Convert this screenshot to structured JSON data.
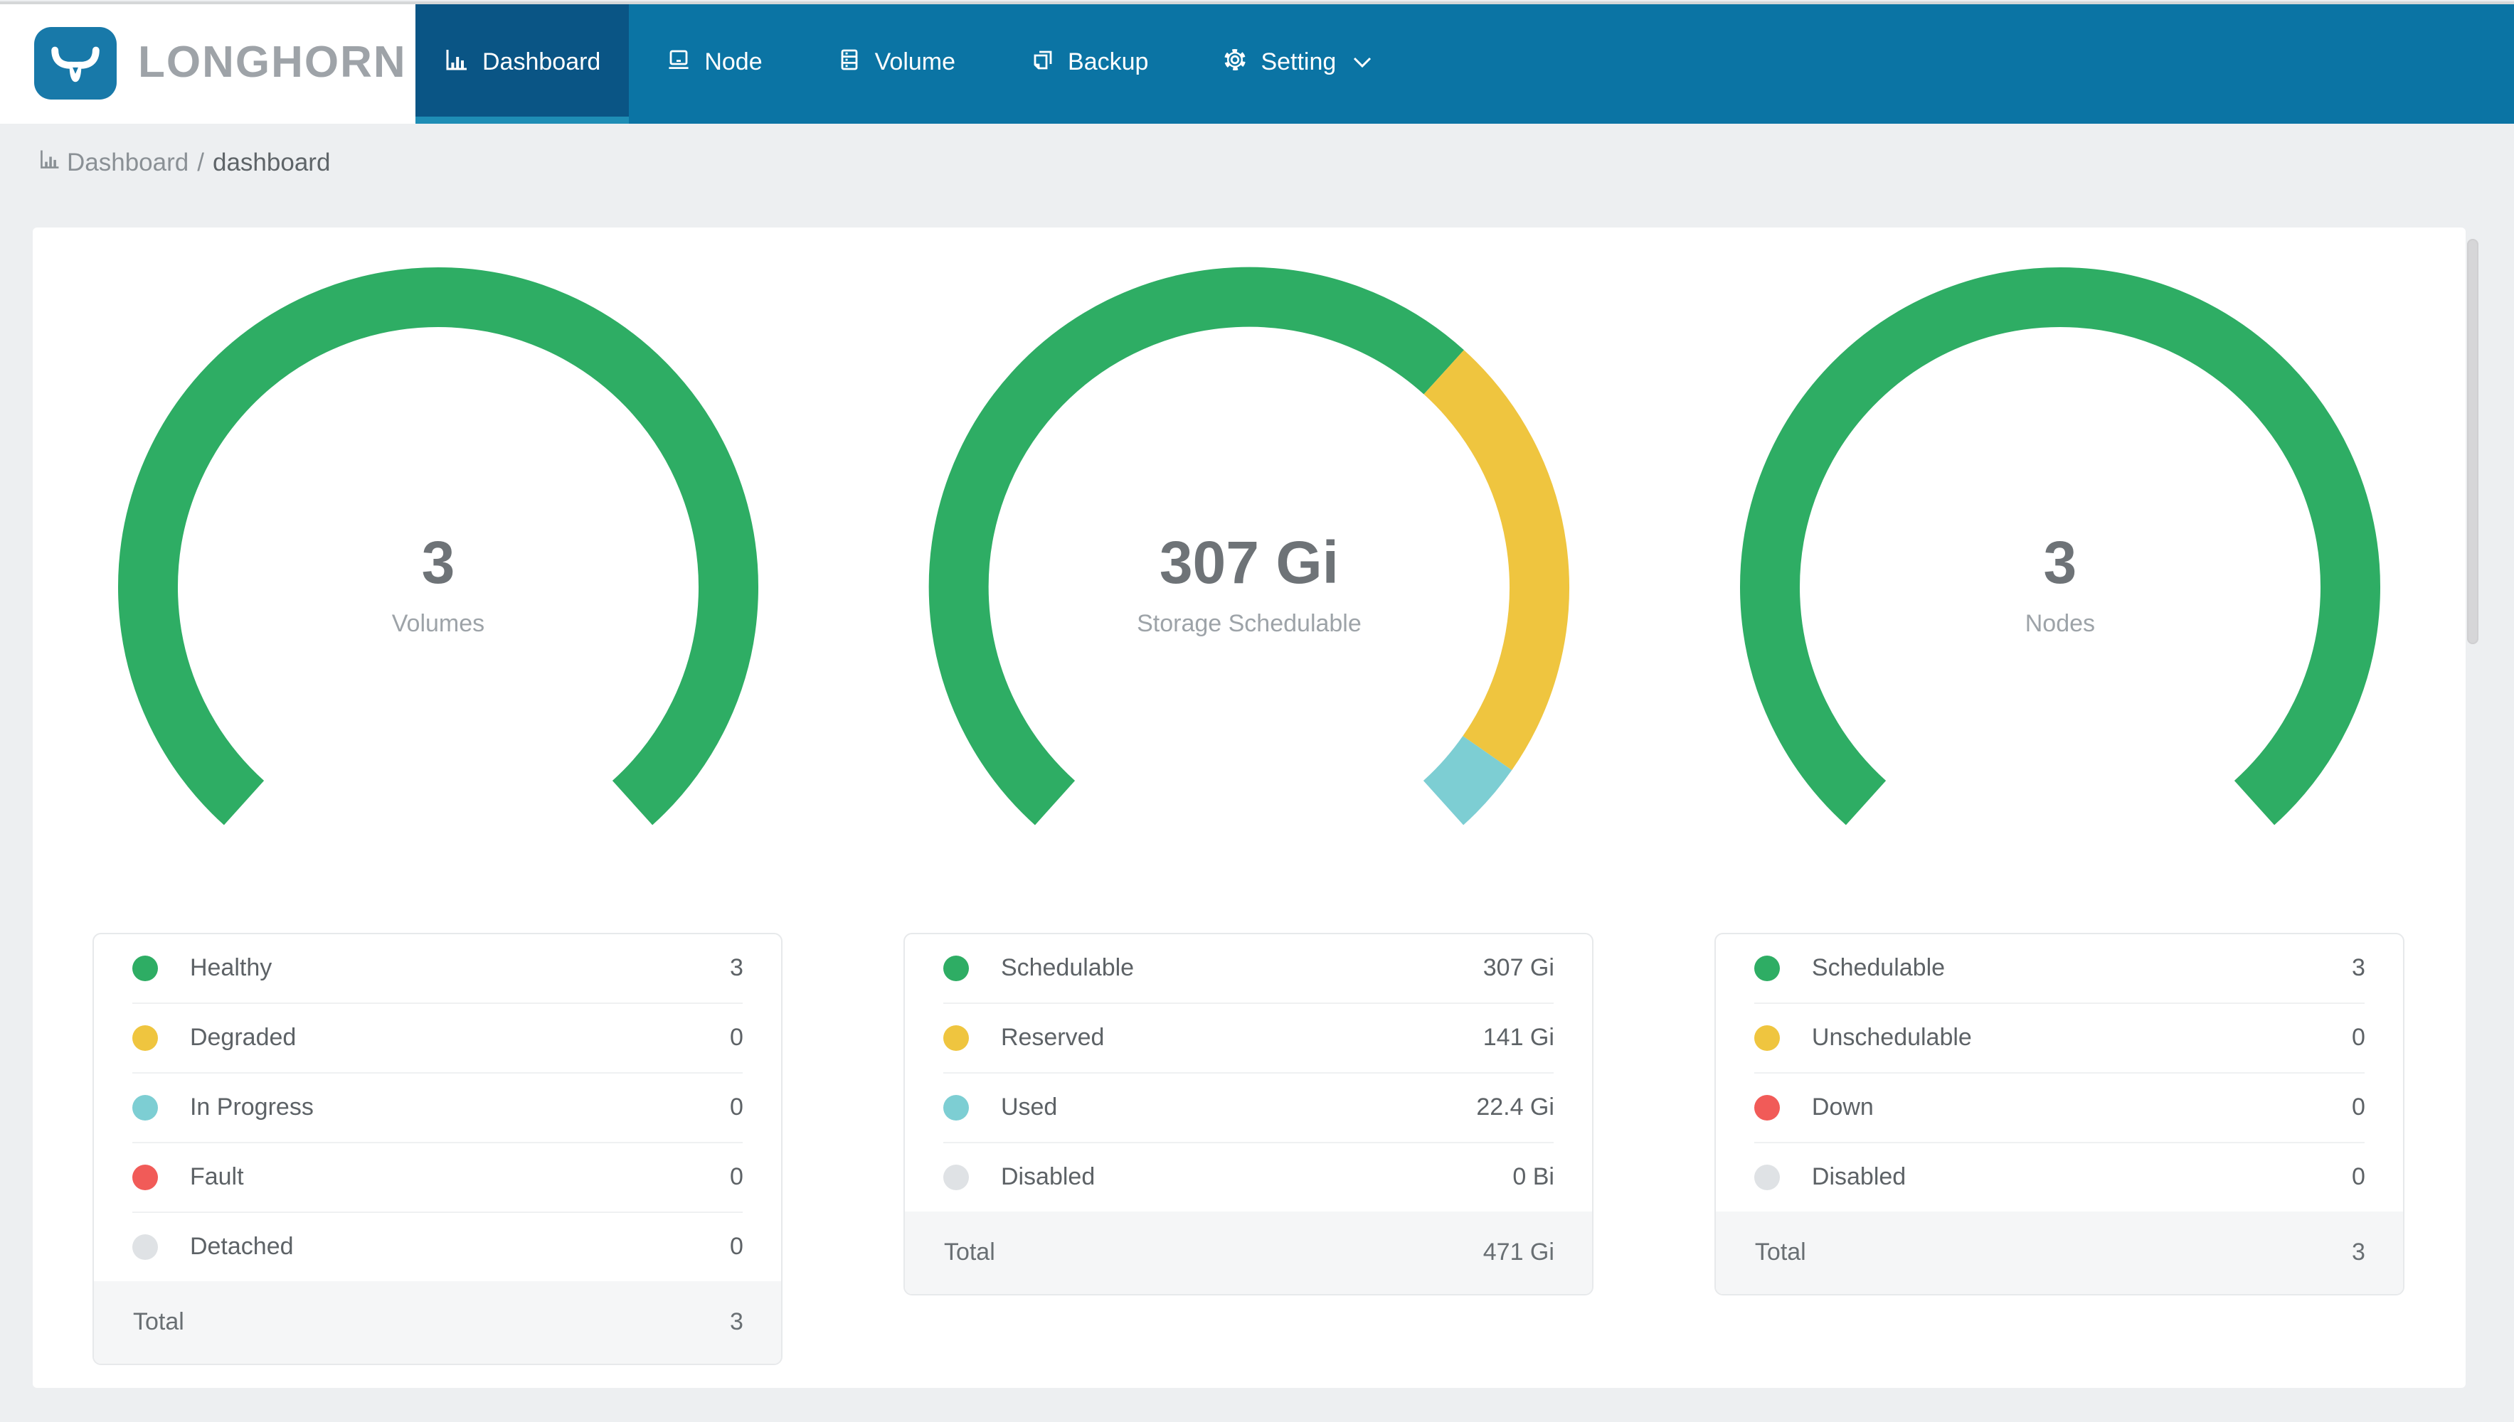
{
  "brand": {
    "name": "LONGHORN",
    "logo_icon": "bull-icon"
  },
  "nav": {
    "items": [
      {
        "label": "Dashboard",
        "icon": "bar-chart-icon",
        "active": true
      },
      {
        "label": "Node",
        "icon": "laptop-icon",
        "active": false
      },
      {
        "label": "Volume",
        "icon": "database-icon",
        "active": false
      },
      {
        "label": "Backup",
        "icon": "copy-icon",
        "active": false
      },
      {
        "label": "Setting",
        "icon": "gear-icon",
        "active": false,
        "has_dropdown": true,
        "dropdown_icon": "chevron-down-icon"
      }
    ]
  },
  "breadcrumb": {
    "icon": "bar-chart-icon",
    "items": [
      "Dashboard",
      "dashboard"
    ],
    "separator": "/"
  },
  "colors": {
    "nav_bg": "#0B74A4",
    "nav_active_bg": "#0A5585",
    "nav_active_underline": "#1E8DB5",
    "logo_blue": "#1879A9",
    "page_bg": "#EDEFF1",
    "card_bg": "#FFFFFF",
    "green": "#2EAD64",
    "yellow": "#EFC53F",
    "teal": "#7DCED3",
    "red": "#F15B58",
    "gray": "#DFE2E5"
  },
  "chart_data": [
    {
      "type": "gauge",
      "title": "Volumes",
      "center_value": "3",
      "center_label": "Volumes",
      "start_angle_deg": 228,
      "sweep_deg": 276,
      "legend_position": "below",
      "segments": [
        {
          "label": "Healthy",
          "value": 3,
          "color": "#2EAD64"
        },
        {
          "label": "Degraded",
          "value": 0,
          "color": "#EFC53F"
        },
        {
          "label": "In Progress",
          "value": 0,
          "color": "#7DCED3"
        },
        {
          "label": "Fault",
          "value": 0,
          "color": "#F15B58"
        },
        {
          "label": "Detached",
          "value": 0,
          "color": "#DFE2E5"
        }
      ],
      "legend": [
        {
          "label": "Healthy",
          "value": "3",
          "color": "#2EAD64"
        },
        {
          "label": "Degraded",
          "value": "0",
          "color": "#EFC53F"
        },
        {
          "label": "In Progress",
          "value": "0",
          "color": "#7DCED3"
        },
        {
          "label": "Fault",
          "value": "0",
          "color": "#F15B58"
        },
        {
          "label": "Detached",
          "value": "0",
          "color": "#DFE2E5"
        }
      ],
      "total_label": "Total",
      "total_value": "3"
    },
    {
      "type": "gauge",
      "title": "Storage Schedulable",
      "center_value": "307 Gi",
      "center_label": "Storage Schedulable",
      "start_angle_deg": 228,
      "sweep_deg": 276,
      "legend_position": "below",
      "segments": [
        {
          "label": "Schedulable",
          "value": 307,
          "color": "#2EAD64"
        },
        {
          "label": "Reserved",
          "value": 141,
          "color": "#EFC53F"
        },
        {
          "label": "Used",
          "value": 22.4,
          "color": "#7DCED3"
        },
        {
          "label": "Disabled",
          "value": 0,
          "color": "#DFE2E5"
        }
      ],
      "legend": [
        {
          "label": "Schedulable",
          "value": "307 Gi",
          "color": "#2EAD64"
        },
        {
          "label": "Reserved",
          "value": "141 Gi",
          "color": "#EFC53F"
        },
        {
          "label": "Used",
          "value": "22.4 Gi",
          "color": "#7DCED3"
        },
        {
          "label": "Disabled",
          "value": "0 Bi",
          "color": "#DFE2E5"
        }
      ],
      "total_label": "Total",
      "total_value": "471 Gi"
    },
    {
      "type": "gauge",
      "title": "Nodes",
      "center_value": "3",
      "center_label": "Nodes",
      "start_angle_deg": 228,
      "sweep_deg": 276,
      "legend_position": "below",
      "segments": [
        {
          "label": "Schedulable",
          "value": 3,
          "color": "#2EAD64"
        },
        {
          "label": "Unschedulable",
          "value": 0,
          "color": "#EFC53F"
        },
        {
          "label": "Down",
          "value": 0,
          "color": "#F15B58"
        },
        {
          "label": "Disabled",
          "value": 0,
          "color": "#DFE2E5"
        }
      ],
      "legend": [
        {
          "label": "Schedulable",
          "value": "3",
          "color": "#2EAD64"
        },
        {
          "label": "Unschedulable",
          "value": "0",
          "color": "#EFC53F"
        },
        {
          "label": "Down",
          "value": "0",
          "color": "#F15B58"
        },
        {
          "label": "Disabled",
          "value": "0",
          "color": "#DFE2E5"
        }
      ],
      "total_label": "Total",
      "total_value": "3"
    }
  ]
}
